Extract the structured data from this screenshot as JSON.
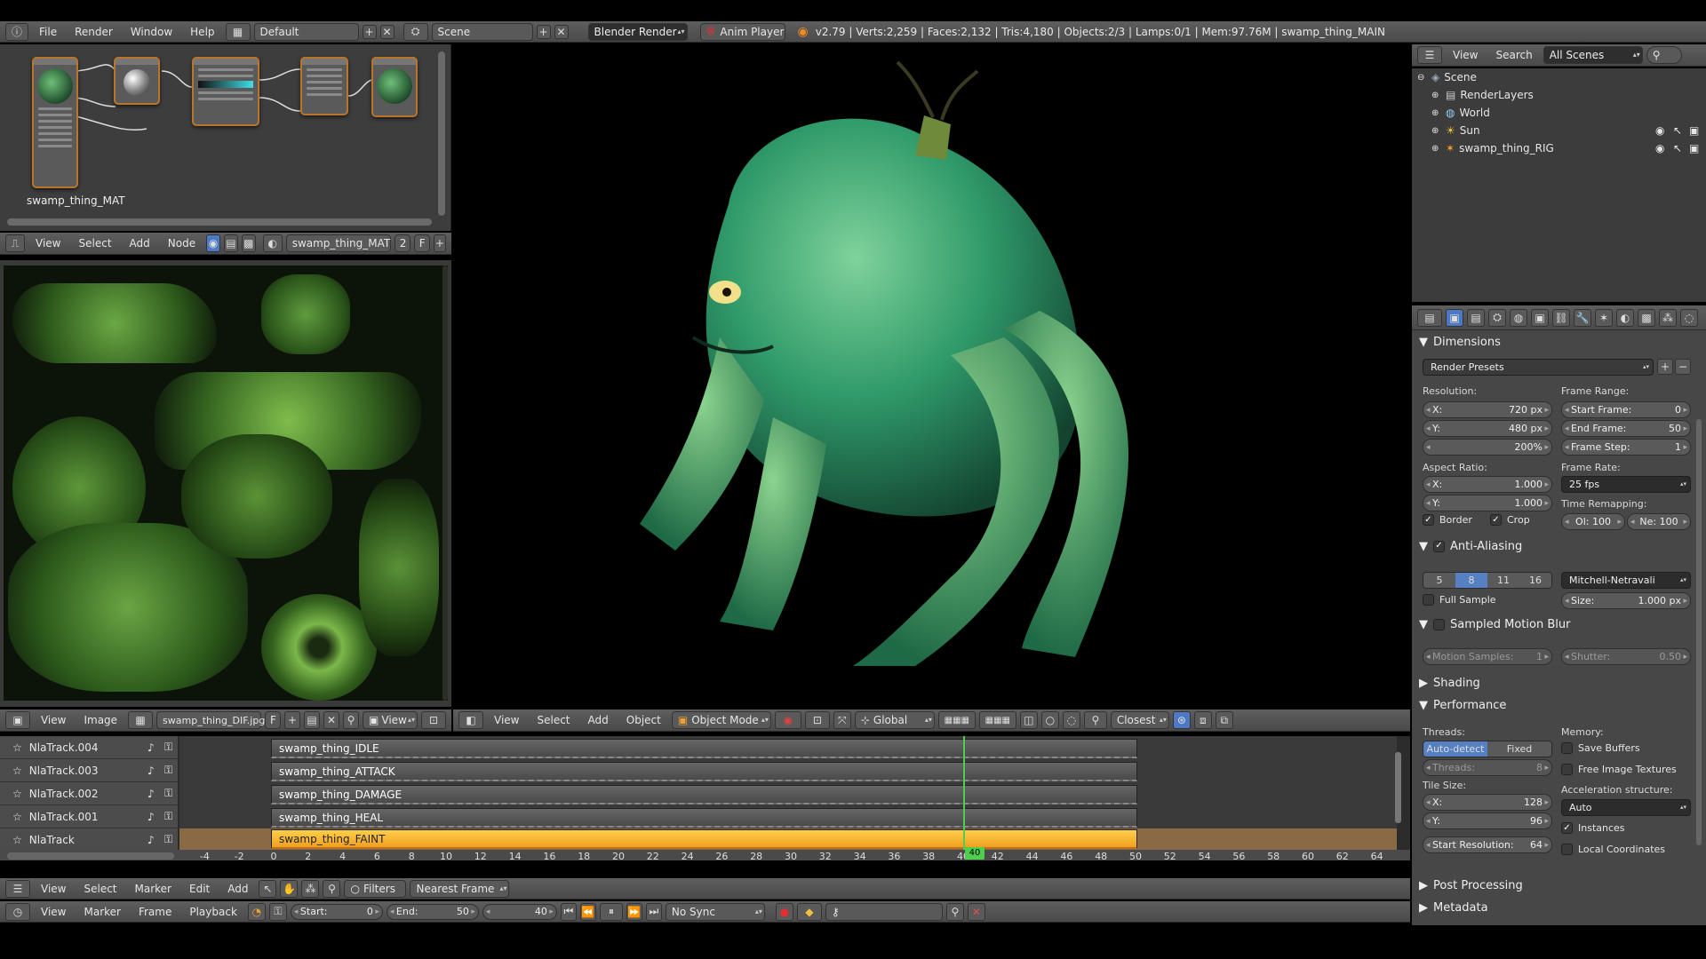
{
  "info_header": {
    "menus": [
      "File",
      "Render",
      "Window",
      "Help"
    ],
    "layout": "Default",
    "scene": "Scene",
    "engine": "Blender Render",
    "anim_player": "Anim Player",
    "stats": "v2.79 | Verts:2,259 | Faces:2,132 | Tris:4,180 | Objects:2/3 | Lamps:0/1 | Mem:97.76M | swamp_thing_MAIN"
  },
  "node_editor": {
    "label": "swamp_thing_MAT",
    "menus": [
      "View",
      "Select",
      "Add",
      "Node"
    ],
    "material": "swamp_thing_MAT",
    "users": "2",
    "fake": "F"
  },
  "image_editor": {
    "menus": [
      "View",
      "Image"
    ],
    "image": "swamp_thing_DIF.jpg",
    "fake": "F",
    "view": "View"
  },
  "viewport_header": {
    "menus": [
      "View",
      "Select",
      "Add",
      "Object"
    ],
    "mode": "Object Mode",
    "orientation": "Global",
    "snap": "Closest"
  },
  "outliner": {
    "menus": [
      "View",
      "Search"
    ],
    "filter": "All Scenes",
    "items": [
      {
        "label": "Scene"
      },
      {
        "label": "RenderLayers"
      },
      {
        "label": "World"
      },
      {
        "label": "Sun"
      },
      {
        "label": "swamp_thing_RIG"
      }
    ]
  },
  "properties": {
    "dimensions": {
      "title": "Dimensions",
      "presets": "Render Presets",
      "resolution_label": "Resolution:",
      "res_x_label": "X:",
      "res_x": "720 px",
      "res_y_label": "Y:",
      "res_y": "480 px",
      "res_pct": "200%",
      "frame_range_label": "Frame Range:",
      "start_label": "Start Frame:",
      "start": "0",
      "end_label": "End Frame:",
      "end": "50",
      "step_label": "Frame Step:",
      "step": "1",
      "aspect_label": "Aspect Ratio:",
      "asp_x_label": "X:",
      "asp_x": "1.000",
      "asp_y_label": "Y:",
      "asp_y": "1.000",
      "frame_rate_label": "Frame Rate:",
      "fps": "25 fps",
      "remap_label": "Time Remapping:",
      "remap_old": "Ol: 100",
      "remap_new": "Ne: 100",
      "border": "Border",
      "crop": "Crop"
    },
    "antialiasing": {
      "title": "Anti-Aliasing",
      "samples": [
        "5",
        "8",
        "11",
        "16"
      ],
      "active_sample": "8",
      "filter": "Mitchell-Netravali",
      "full_sample": "Full Sample",
      "size_label": "Size:",
      "size": "1.000 px"
    },
    "motion_blur": {
      "title": "Sampled Motion Blur",
      "samples_label": "Motion Samples:",
      "samples": "1",
      "shutter_label": "Shutter:",
      "shutter": "0.50"
    },
    "shading": {
      "title": "Shading"
    },
    "performance": {
      "title": "Performance",
      "threads_label": "Threads:",
      "auto": "Auto-detect",
      "fixed": "Fixed",
      "threads_num_label": "Threads:",
      "threads_num": "8",
      "memory_label": "Memory:",
      "save_buffers": "Save Buffers",
      "free_textures": "Free Image Textures",
      "tile_label": "Tile Size:",
      "tile_x_label": "X:",
      "tile_x": "128",
      "tile_y_label": "Y:",
      "tile_y": "96",
      "accel_label": "Acceleration structure:",
      "accel": "Auto",
      "instances": "Instances",
      "start_res_label": "Start Resolution:",
      "start_res": "64",
      "local_coords": "Local Coordinates"
    },
    "post_processing": {
      "title": "Post Processing"
    },
    "metadata": {
      "title": "Metadata"
    }
  },
  "nla": {
    "tracks": [
      "NlaTrack.004",
      "NlaTrack.003",
      "NlaTrack.002",
      "NlaTrack.001",
      "NlaTrack"
    ],
    "strips": [
      "swamp_thing_IDLE",
      "swamp_thing_ATTACK",
      "swamp_thing_DAMAGE",
      "swamp_thing_HEAL",
      "swamp_thing_FAINT"
    ],
    "ruler": [
      "-4",
      "-2",
      "0",
      "2",
      "4",
      "6",
      "8",
      "10",
      "12",
      "14",
      "16",
      "18",
      "20",
      "22",
      "24",
      "26",
      "28",
      "30",
      "32",
      "34",
      "36",
      "38",
      "40",
      "42",
      "44",
      "46",
      "48",
      "50",
      "52",
      "54",
      "56",
      "58",
      "60",
      "62",
      "64"
    ],
    "current_frame": "40",
    "menus": [
      "View",
      "Select",
      "Marker",
      "Edit",
      "Add"
    ],
    "filters": "Filters",
    "snap": "Nearest Frame"
  },
  "timeline": {
    "menus": [
      "View",
      "Marker",
      "Frame",
      "Playback"
    ],
    "start_label": "Start:",
    "start": "0",
    "end_label": "End:",
    "end": "50",
    "current": "40",
    "sync": "No Sync"
  }
}
